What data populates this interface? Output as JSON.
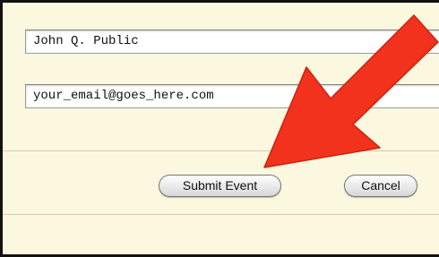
{
  "form": {
    "name_value": "John Q. Public",
    "email_value": "your_email@goes_here.com"
  },
  "buttons": {
    "submit_label": "Submit Event",
    "cancel_label": "Cancel"
  },
  "annotation": {
    "arrow_color": "#f2321c"
  },
  "theme": {
    "panel_background": "#fbf8df",
    "frame_border": "#111111"
  }
}
